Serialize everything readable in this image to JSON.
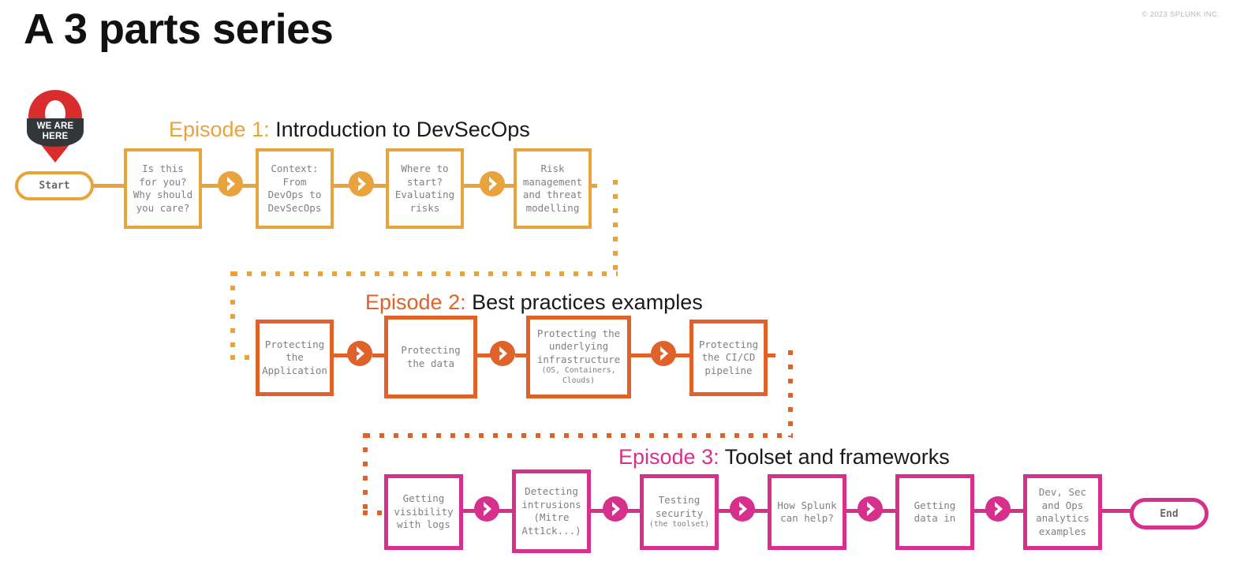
{
  "page": {
    "title": "A 3 parts series",
    "copyright": "© 2023 SPLUNK INC."
  },
  "colors": {
    "episode1": "#E8A33D",
    "episode2": "#E0622B",
    "episode3": "#D6308C",
    "pin_red": "#D92D2D",
    "pin_banner": "#33373A",
    "node_text": "#808080",
    "title_text": "#111111",
    "copyright_text": "#b8b8b8"
  },
  "pin": {
    "name": "we-are-here-pin",
    "line1": "WE ARE",
    "line2": "HERE"
  },
  "terminals": {
    "start": "Start",
    "end": "End"
  },
  "episodes": [
    {
      "id": "episode-1",
      "label": "Episode 1:",
      "title": "Introduction to DevSecOps",
      "color": "#E8A33D",
      "nodes": [
        {
          "text": "Is this\nfor you?\nWhy should\nyou care?"
        },
        {
          "text": "Context:\nFrom\nDevOps to\nDevSecOps"
        },
        {
          "text": "Where to\nstart?\nEvaluating\nrisks"
        },
        {
          "text": "Risk\nmanagement\nand threat\nmodelling"
        }
      ]
    },
    {
      "id": "episode-2",
      "label": "Episode 2:",
      "title": "Best practices examples",
      "color": "#E0622B",
      "nodes": [
        {
          "text": "Protecting\nthe\nApplication"
        },
        {
          "text": "Protecting\nthe data"
        },
        {
          "text": "Protecting the\nunderlying\ninfrastructure",
          "sub": "(OS, Containers,\nClouds)"
        },
        {
          "text": "Protecting\nthe CI/CD\npipeline"
        }
      ]
    },
    {
      "id": "episode-3",
      "label": "Episode 3:",
      "title": "Toolset and frameworks",
      "color": "#D6308C",
      "nodes": [
        {
          "text": "Getting\nvisibility\nwith logs"
        },
        {
          "text": "Detecting\nintrusions\n(Mitre\nAtt1ck...)"
        },
        {
          "text": "Testing\nsecurity",
          "sub": "(the toolset)"
        },
        {
          "text": "How Splunk\ncan help?"
        },
        {
          "text": "Getting\ndata in"
        },
        {
          "text": "Dev, Sec\nand Ops\nanalytics\nexamples"
        }
      ]
    }
  ]
}
